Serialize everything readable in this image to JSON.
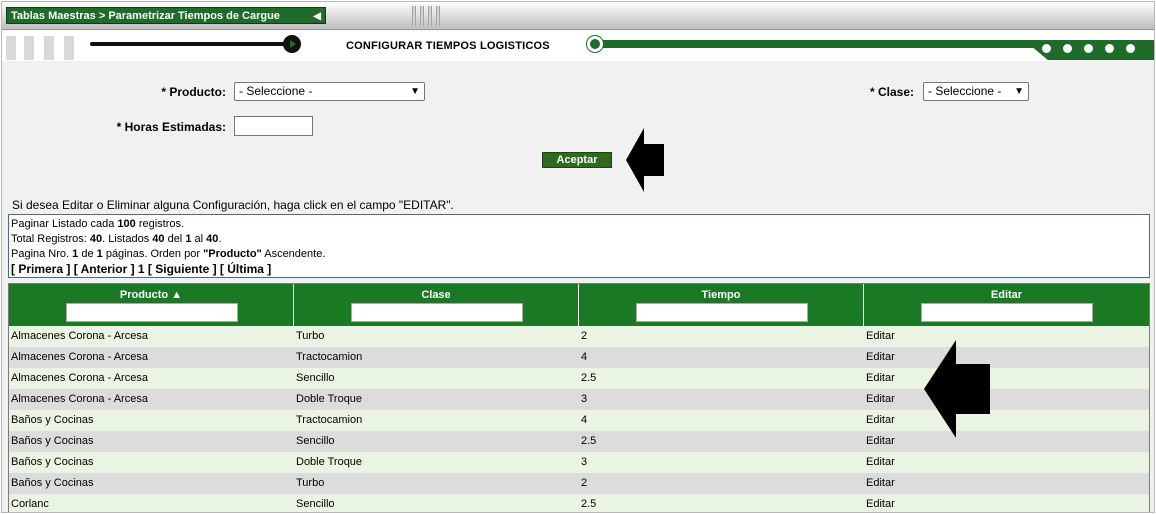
{
  "breadcrumb": "Tablas Maestras > Parametrizar Tiempos de Cargue",
  "step_title": "CONFIGURAR TIEMPOS LOGISTICOS",
  "form": {
    "producto_label": "* Producto:",
    "producto_value": "- Seleccione -",
    "clase_label": "* Clase:",
    "clase_value": "- Seleccione -",
    "horas_label": "* Horas Estimadas:",
    "horas_value": "",
    "accept_label": "Aceptar"
  },
  "hint": "Si desea Editar o Eliminar alguna Configuración, haga click en el campo \"EDITAR\".",
  "pagination": {
    "line1_pre": "Paginar Listado cada ",
    "line1_num": "100",
    "line1_post": " registros.",
    "line2_pre": "Total Registros: ",
    "total": "40",
    "line2_mid1": ". Listados ",
    "listed": "40",
    "line2_mid2": " del ",
    "from": "1",
    "line2_mid3": " al ",
    "to": "40",
    "line2_end": ".",
    "line3_pre": "Pagina Nro. ",
    "page": "1",
    "line3_mid": " de ",
    "pages": "1",
    "line3_mid2": " páginas. Orden por ",
    "order_field": "\"Producto\"",
    "line3_end": " Ascendente.",
    "nav": "[ Primera ] [ Anterior ] 1 [ Siguiente ] [ Última ]"
  },
  "table": {
    "headers": [
      "Producto",
      "Clase",
      "Tiempo",
      "Editar"
    ],
    "sort_indicator": "▲",
    "rows": [
      [
        "Almacenes Corona - Arcesa",
        "Turbo",
        "2",
        "Editar"
      ],
      [
        "Almacenes Corona - Arcesa",
        "Tractocamion",
        "4",
        "Editar"
      ],
      [
        "Almacenes Corona - Arcesa",
        "Sencillo",
        "2.5",
        "Editar"
      ],
      [
        "Almacenes Corona - Arcesa",
        "Doble Troque",
        "3",
        "Editar"
      ],
      [
        "Baños y Cocinas",
        "Tractocamion",
        "4",
        "Editar"
      ],
      [
        "Baños y Cocinas",
        "Sencillo",
        "2.5",
        "Editar"
      ],
      [
        "Baños y Cocinas",
        "Doble Troque",
        "3",
        "Editar"
      ],
      [
        "Baños y Cocinas",
        "Turbo",
        "2",
        "Editar"
      ],
      [
        "Corlanc",
        "Sencillo",
        "2.5",
        "Editar"
      ]
    ]
  },
  "colors": {
    "brand_green": "#1f6b2a",
    "header_green": "#1a7a24",
    "row_odd": "#eaf4e2",
    "row_even": "#dcdcdc"
  }
}
